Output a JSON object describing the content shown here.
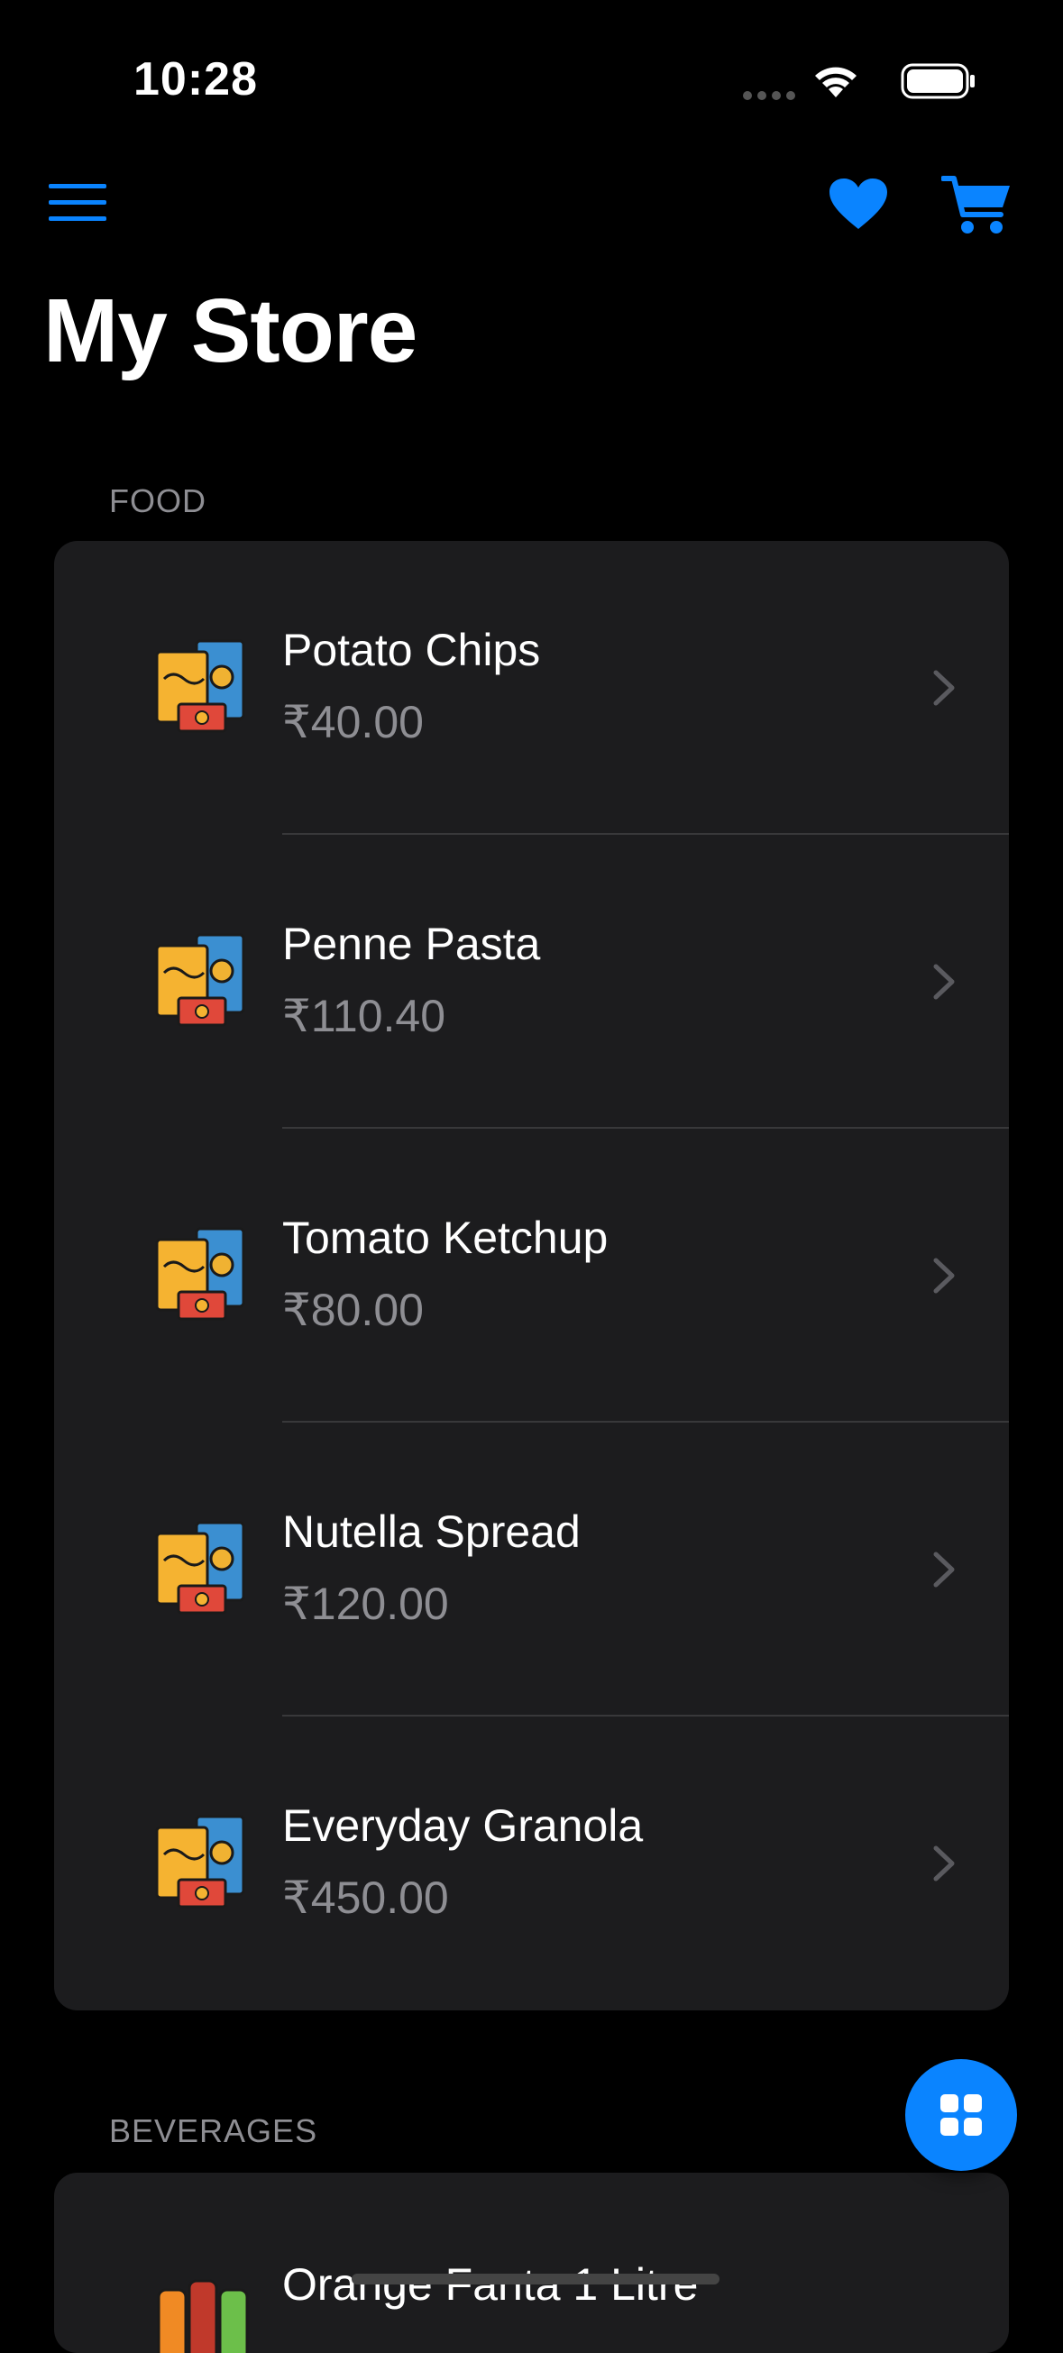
{
  "status_bar": {
    "time": "10:28"
  },
  "nav": {
    "menu_icon": "hamburger-menu-icon",
    "favorites_icon": "heart-icon",
    "cart_icon": "cart-icon",
    "accent_color": "#0a84ff"
  },
  "page_title": "My Store",
  "sections": [
    {
      "header": "FOOD",
      "items": [
        {
          "name": "Potato Chips",
          "price": "₹40.00",
          "icon": "snacks-icon"
        },
        {
          "name": "Penne Pasta",
          "price": "₹110.40",
          "icon": "snacks-icon"
        },
        {
          "name": "Tomato Ketchup",
          "price": "₹80.00",
          "icon": "snacks-icon"
        },
        {
          "name": "Nutella Spread",
          "price": "₹120.00",
          "icon": "snacks-icon"
        },
        {
          "name": "Everyday Granola",
          "price": "₹450.00",
          "icon": "snacks-icon"
        }
      ]
    },
    {
      "header": "BEVERAGES",
      "items": [
        {
          "name": "Orange Fanta 1 Litre",
          "icon": "bottles-icon"
        }
      ]
    }
  ],
  "fab": {
    "icon": "grid-icon"
  }
}
